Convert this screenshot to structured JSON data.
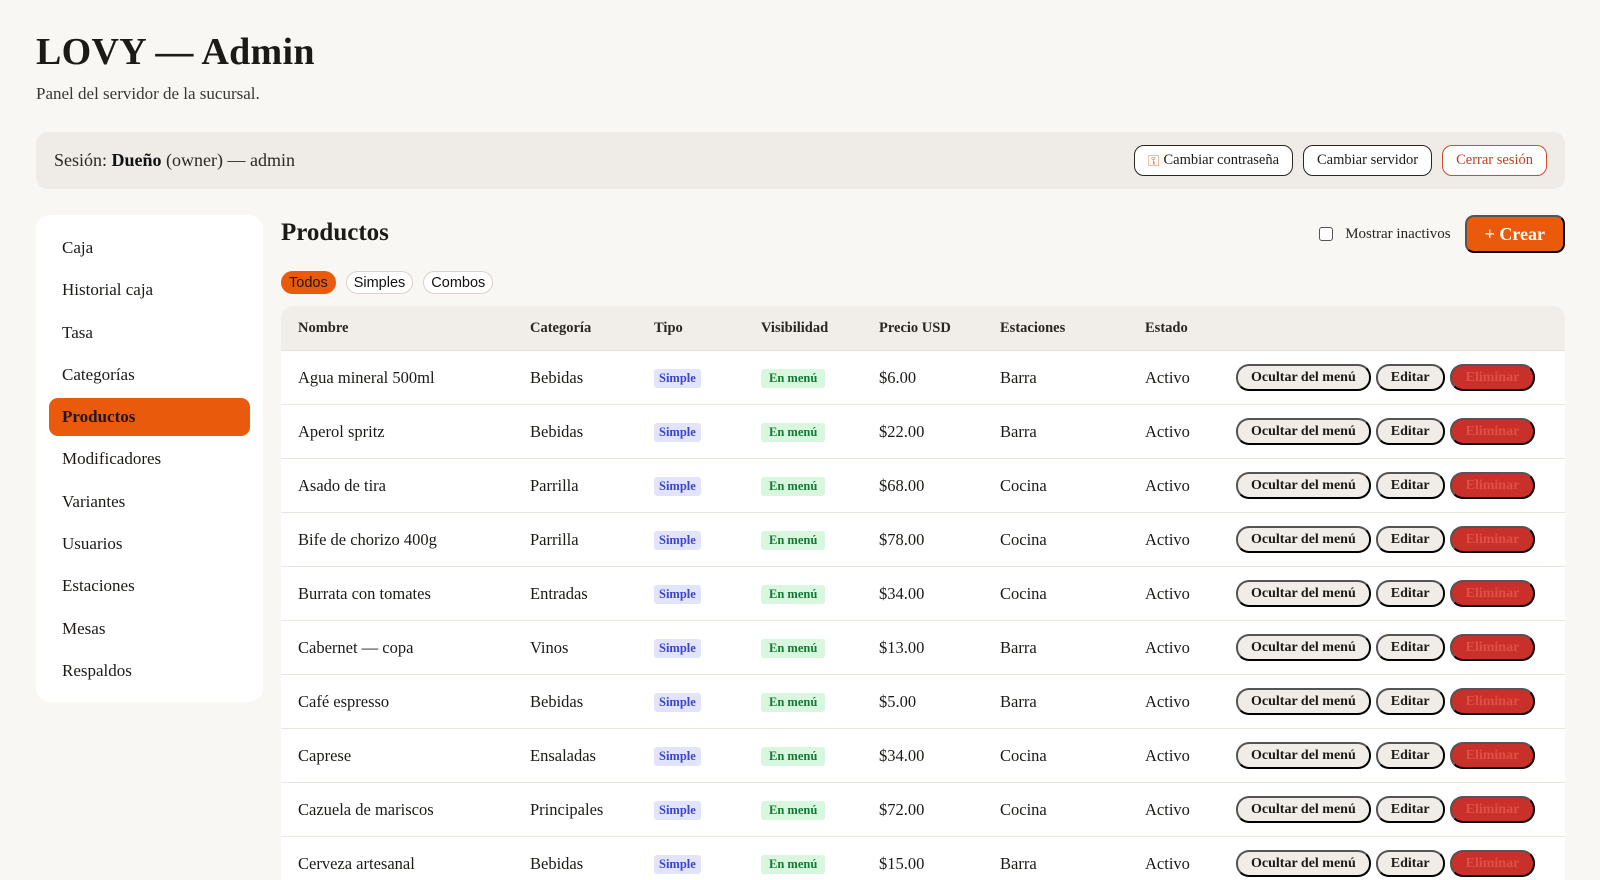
{
  "header": {
    "title": "LOVY — Admin",
    "subtitle": "Panel del servidor de la sucursal."
  },
  "session": {
    "prefix": "Sesión: ",
    "role": "Dueño",
    "suffix": " (owner) — admin",
    "change_password_label": "Cambiar contraseña",
    "change_password_icon": "key-icon",
    "change_server_label": "Cambiar servidor",
    "logout_label": "Cerrar sesión"
  },
  "sidebar": {
    "active": "Productos",
    "items": [
      {
        "key": "caja",
        "label": "Caja"
      },
      {
        "key": "historial-caja",
        "label": "Historial caja"
      },
      {
        "key": "tasa",
        "label": "Tasa"
      },
      {
        "key": "categorias",
        "label": "Categorías"
      },
      {
        "key": "productos",
        "label": "Productos"
      },
      {
        "key": "modificadores",
        "label": "Modificadores"
      },
      {
        "key": "variantes",
        "label": "Variantes"
      },
      {
        "key": "usuarios",
        "label": "Usuarios"
      },
      {
        "key": "estaciones",
        "label": "Estaciones"
      },
      {
        "key": "mesas",
        "label": "Mesas"
      },
      {
        "key": "respaldos",
        "label": "Respaldos"
      }
    ]
  },
  "main": {
    "title": "Productos",
    "show_inactive_label": "Mostrar inactivos",
    "show_inactive_checked": false,
    "create_label": "+ Crear",
    "filters": {
      "active": "Todos",
      "items": [
        "Todos",
        "Simples",
        "Combos"
      ]
    },
    "table": {
      "headers": {
        "name": "Nombre",
        "category": "Categoría",
        "type": "Tipo",
        "visibility": "Visibilidad",
        "price": "Precio USD",
        "stations": "Estaciones",
        "state": "Estado"
      },
      "action_labels": {
        "hide": "Ocultar del menú",
        "edit": "Editar",
        "delete": "Eliminar"
      },
      "rows": [
        {
          "name": "Agua mineral 500ml",
          "category": "Bebidas",
          "type": "Simple",
          "visibility": "En menú",
          "price": "$6.00",
          "stations": "Barra",
          "state": "Activo"
        },
        {
          "name": "Aperol spritz",
          "category": "Bebidas",
          "type": "Simple",
          "visibility": "En menú",
          "price": "$22.00",
          "stations": "Barra",
          "state": "Activo"
        },
        {
          "name": "Asado de tira",
          "category": "Parrilla",
          "type": "Simple",
          "visibility": "En menú",
          "price": "$68.00",
          "stations": "Cocina",
          "state": "Activo"
        },
        {
          "name": "Bife de chorizo 400g",
          "category": "Parrilla",
          "type": "Simple",
          "visibility": "En menú",
          "price": "$78.00",
          "stations": "Cocina",
          "state": "Activo"
        },
        {
          "name": "Burrata con tomates",
          "category": "Entradas",
          "type": "Simple",
          "visibility": "En menú",
          "price": "$34.00",
          "stations": "Cocina",
          "state": "Activo"
        },
        {
          "name": "Cabernet — copa",
          "category": "Vinos",
          "type": "Simple",
          "visibility": "En menú",
          "price": "$13.00",
          "stations": "Barra",
          "state": "Activo"
        },
        {
          "name": "Café espresso",
          "category": "Bebidas",
          "type": "Simple",
          "visibility": "En menú",
          "price": "$5.00",
          "stations": "Barra",
          "state": "Activo"
        },
        {
          "name": "Caprese",
          "category": "Ensaladas",
          "type": "Simple",
          "visibility": "En menú",
          "price": "$34.00",
          "stations": "Cocina",
          "state": "Activo"
        },
        {
          "name": "Cazuela de mariscos",
          "category": "Principales",
          "type": "Simple",
          "visibility": "En menú",
          "price": "$72.00",
          "stations": "Cocina",
          "state": "Activo"
        },
        {
          "name": "Cerveza artesanal",
          "category": "Bebidas",
          "type": "Simple",
          "visibility": "En menú",
          "price": "$15.00",
          "stations": "Barra",
          "state": "Activo"
        }
      ]
    }
  },
  "colors": {
    "accent": "#ea5a0c",
    "danger": "#c9302a",
    "badge_simple_bg": "#e2e4fb",
    "badge_menu_bg": "#d9f6df"
  }
}
